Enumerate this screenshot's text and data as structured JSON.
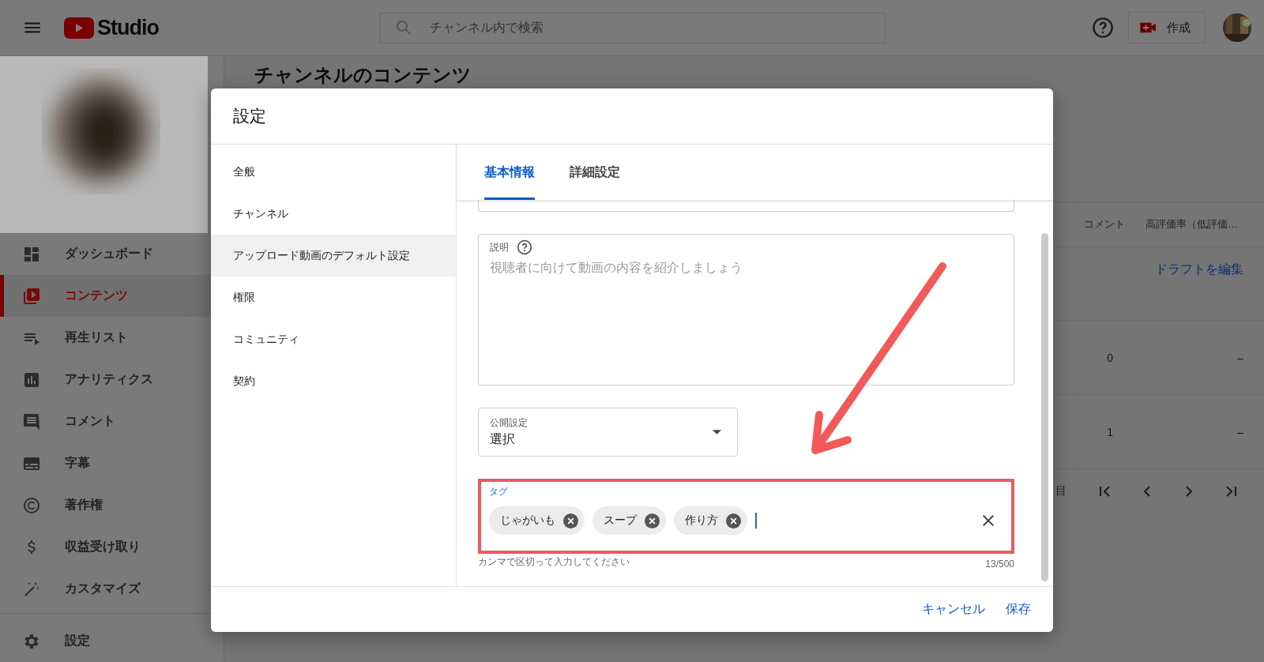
{
  "header": {
    "logo_text": "Studio",
    "search": {
      "placeholder": "チャンネル内で検索"
    },
    "create_button": "作成"
  },
  "sidebar": {
    "items": [
      {
        "label": "ダッシュボード",
        "selected": false
      },
      {
        "label": "コンテンツ",
        "selected": true
      },
      {
        "label": "再生リスト",
        "selected": false
      },
      {
        "label": "アナリティクス",
        "selected": false
      },
      {
        "label": "コメント",
        "selected": false
      },
      {
        "label": "字幕",
        "selected": false
      },
      {
        "label": "著作権",
        "selected": false
      },
      {
        "label": "収益受け取り",
        "selected": false
      },
      {
        "label": "カスタマイズ",
        "selected": false
      }
    ],
    "footer_item": {
      "label": "設定",
      "selected": false
    }
  },
  "page": {
    "title": "チャンネルのコンテンツ",
    "table": {
      "columns": [
        "コメント",
        "高評価率（低評価…"
      ],
      "rows": [
        {
          "link": "ドラフトを編集"
        },
        {
          "comments": "0",
          "like_rate": "–"
        },
        {
          "comments": "1",
          "like_rate": "–"
        }
      ]
    },
    "pagination": {
      "range_text": "目"
    }
  },
  "dialog": {
    "title": "設定",
    "nav": [
      {
        "label": "全般",
        "selected": false
      },
      {
        "label": "チャンネル",
        "selected": false
      },
      {
        "label": "アップロード動画のデフォルト設定",
        "selected": true
      },
      {
        "label": "権限",
        "selected": false
      },
      {
        "label": "コミュニティ",
        "selected": false
      },
      {
        "label": "契約",
        "selected": false
      }
    ],
    "tabs": [
      {
        "label": "基本情報",
        "selected": true
      },
      {
        "label": "詳細設定",
        "selected": false
      }
    ],
    "description": {
      "label": "説明",
      "placeholder": "視聴者に向けて動画の内容を紹介しましょう"
    },
    "visibility": {
      "label": "公開設定",
      "value": "選択"
    },
    "tags": {
      "label": "タグ",
      "chips": [
        "じゃがいも",
        "スープ",
        "作り方"
      ],
      "hint": "カンマで区切って入力してください",
      "counter": "13/500",
      "highlighted": true
    },
    "buttons": {
      "cancel": "キャンセル",
      "save": "保存"
    }
  }
}
